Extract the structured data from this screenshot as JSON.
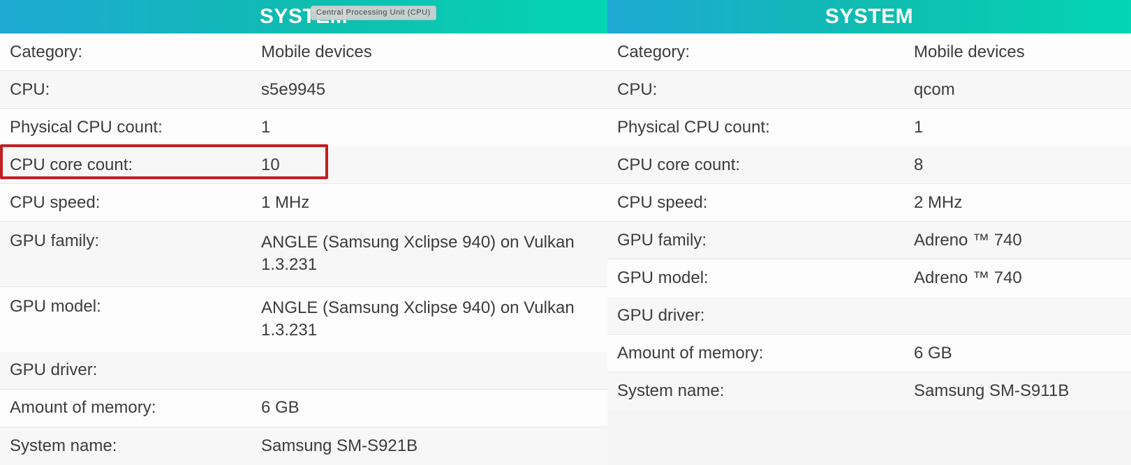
{
  "left": {
    "header_title": "SYSTEM",
    "tooltip": "Central Processing Unit (CPU)",
    "rows": {
      "category": {
        "label": "Category:",
        "value": "Mobile devices"
      },
      "cpu": {
        "label": "CPU:",
        "value": "s5e9945"
      },
      "physical_cpu": {
        "label": "Physical CPU count:",
        "value": "1"
      },
      "cpu_cores": {
        "label": "CPU core count:",
        "value": "10"
      },
      "cpu_speed": {
        "label": "CPU speed:",
        "value": "1 MHz"
      },
      "gpu_family": {
        "label": "GPU family:",
        "value": "ANGLE (Samsung Xclipse 940) on Vulkan 1.3.231"
      },
      "gpu_model": {
        "label": "GPU model:",
        "value": "ANGLE (Samsung Xclipse 940) on Vulkan 1.3.231"
      },
      "gpu_driver": {
        "label": "GPU driver:",
        "value": ""
      },
      "memory": {
        "label": "Amount of memory:",
        "value": "6 GB"
      },
      "system_name": {
        "label": "System name:",
        "value": "Samsung SM-S921B"
      }
    }
  },
  "right": {
    "header_title": "SYSTEM",
    "rows": {
      "category": {
        "label": "Category:",
        "value": "Mobile devices"
      },
      "cpu": {
        "label": "CPU:",
        "value": "qcom"
      },
      "physical_cpu": {
        "label": "Physical CPU count:",
        "value": "1"
      },
      "cpu_cores": {
        "label": "CPU core count:",
        "value": "8"
      },
      "cpu_speed": {
        "label": "CPU speed:",
        "value": "2 MHz"
      },
      "gpu_family": {
        "label": "GPU family:",
        "value": "Adreno ™ 740"
      },
      "gpu_model": {
        "label": "GPU model:",
        "value": "Adreno ™ 740"
      },
      "gpu_driver": {
        "label": "GPU driver:",
        "value": ""
      },
      "memory": {
        "label": "Amount of memory:",
        "value": "6 GB"
      },
      "system_name": {
        "label": "System name:",
        "value": "Samsung SM-S911B"
      }
    }
  }
}
